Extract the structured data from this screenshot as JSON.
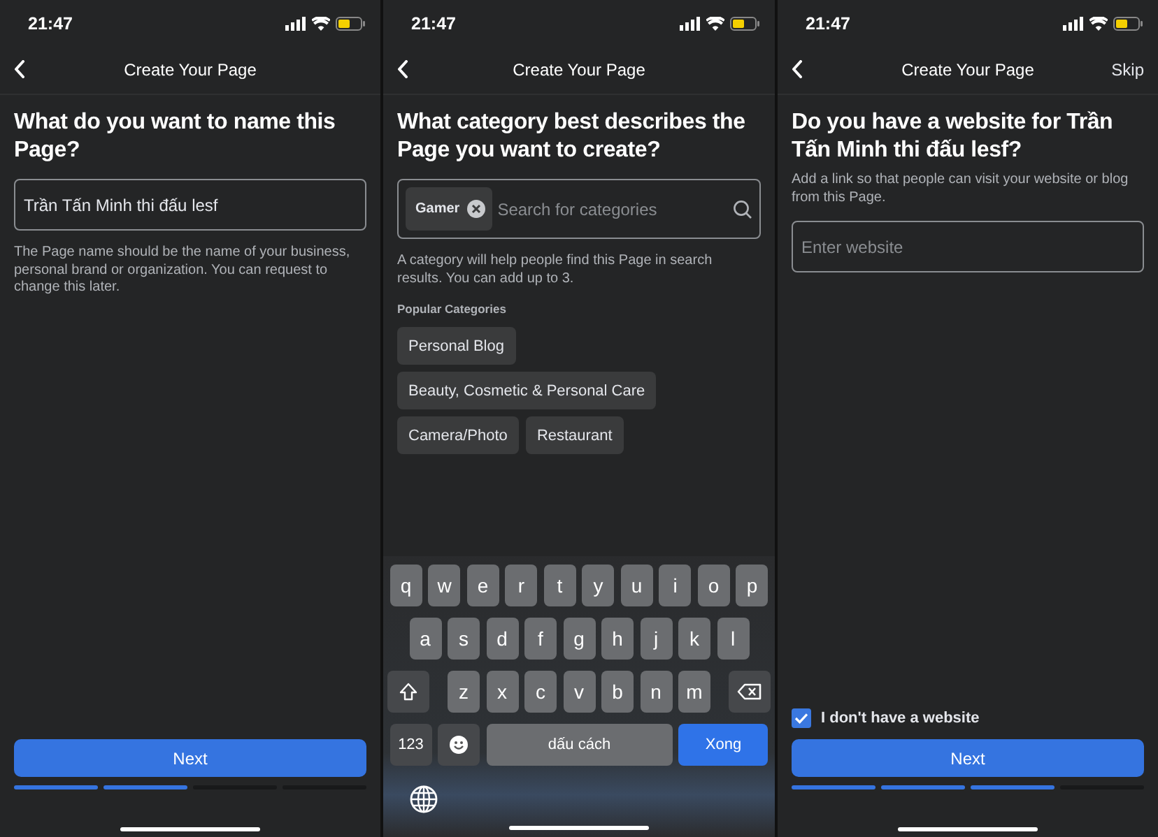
{
  "screens": [
    {
      "kind": "name",
      "status": {
        "time": "21:47"
      },
      "header": {
        "title": "Create Your Page"
      },
      "heading": "What do you want to name this Page?",
      "field": {
        "value": "Trần Tấn Minh thi đấu lesf"
      },
      "help": "The Page name should be the name of your business, personal brand or organization. You can request to change this later.",
      "next_button": "Next",
      "progress": [
        {
          "done": true
        },
        {
          "done": true
        },
        {
          "done": false
        },
        {
          "done": false
        }
      ]
    },
    {
      "kind": "category",
      "status": {
        "time": "21:47"
      },
      "header": {
        "title": "Create Your Page"
      },
      "heading": "What category best describes the Page you want to create?",
      "search": {
        "chip": "Gamer",
        "placeholder": "Search for categories"
      },
      "help": "A category will help people find this Page in search results. You can add up to 3.",
      "section_label": "Popular Categories",
      "categories": [
        "Personal Blog",
        "Beauty, Cosmetic & Personal Care",
        "Camera/Photo",
        "Restaurant"
      ],
      "keyboard": {
        "rows": [
          [
            "q",
            "w",
            "e",
            "r",
            "t",
            "y",
            "u",
            "i",
            "o",
            "p"
          ],
          [
            "a",
            "s",
            "d",
            "f",
            "g",
            "h",
            "j",
            "k",
            "l"
          ],
          [
            "z",
            "x",
            "c",
            "v",
            "b",
            "n",
            "m"
          ]
        ],
        "numbers_key": "123",
        "space_key": "dấu cách",
        "return_key": "Xong"
      }
    },
    {
      "kind": "website",
      "status": {
        "time": "21:47"
      },
      "header": {
        "title": "Create Your Page",
        "action": "Skip"
      },
      "heading": "Do you have a website for Trần Tấn Minh thi đấu lesf?",
      "subtitle": "Add a link so that people can visit your website or blog from this Page.",
      "field": {
        "placeholder": "Enter website"
      },
      "checkbox": {
        "label": "I don't have a website",
        "checked": true
      },
      "next_button": "Next",
      "progress": [
        {
          "done": true
        },
        {
          "done": true
        },
        {
          "done": true
        },
        {
          "done": false
        }
      ]
    }
  ]
}
